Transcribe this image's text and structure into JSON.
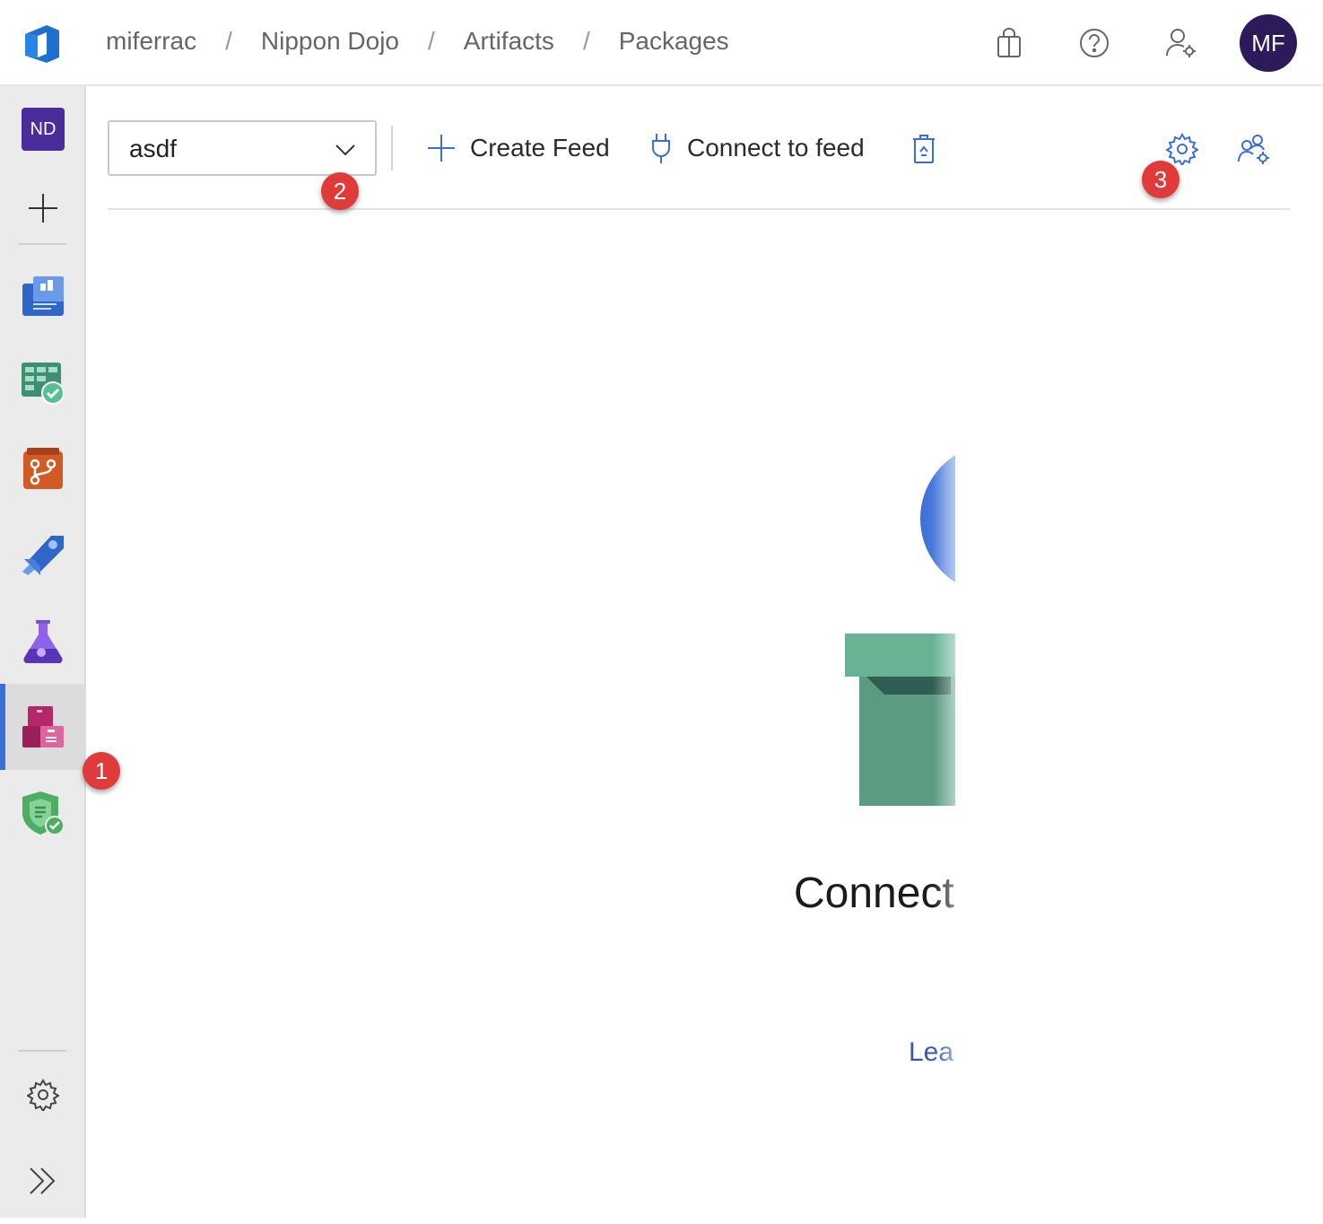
{
  "breadcrumb": {
    "org": "miferrac",
    "project": "Nippon Dojo",
    "hub": "Artifacts",
    "page": "Packages",
    "separator": "/"
  },
  "header": {
    "avatar_initials": "MF",
    "icons": [
      "shopping-bag-icon",
      "help-icon",
      "user-settings-icon"
    ]
  },
  "sidebar": {
    "project_badge": "ND",
    "items": [
      {
        "name": "new-project",
        "icon": "plus-icon"
      },
      {
        "name": "overview",
        "icon": "overview-icon"
      },
      {
        "name": "boards",
        "icon": "boards-icon"
      },
      {
        "name": "repos",
        "icon": "repos-icon"
      },
      {
        "name": "pipelines",
        "icon": "pipelines-icon"
      },
      {
        "name": "test-plans",
        "icon": "test-plans-icon"
      },
      {
        "name": "artifacts",
        "icon": "artifacts-icon",
        "active": true
      },
      {
        "name": "security",
        "icon": "shield-icon"
      }
    ],
    "footer": [
      {
        "name": "project-settings",
        "icon": "gear-icon"
      },
      {
        "name": "expand",
        "icon": "double-chevron-icon"
      }
    ]
  },
  "toolbar": {
    "feed_value": "asdf",
    "create_feed_label": "Create Feed",
    "connect_feed_label": "Connect to feed"
  },
  "callouts": [
    "1",
    "2",
    "3"
  ],
  "empty_state": {
    "headline": "Connect",
    "link": "Lea"
  },
  "colors": {
    "accent": "#3a6fd8",
    "avatar_bg": "#2c1a5a",
    "badge": "#e03a3a",
    "project_badge": "#4b2c9b",
    "link": "#3a57a8"
  }
}
